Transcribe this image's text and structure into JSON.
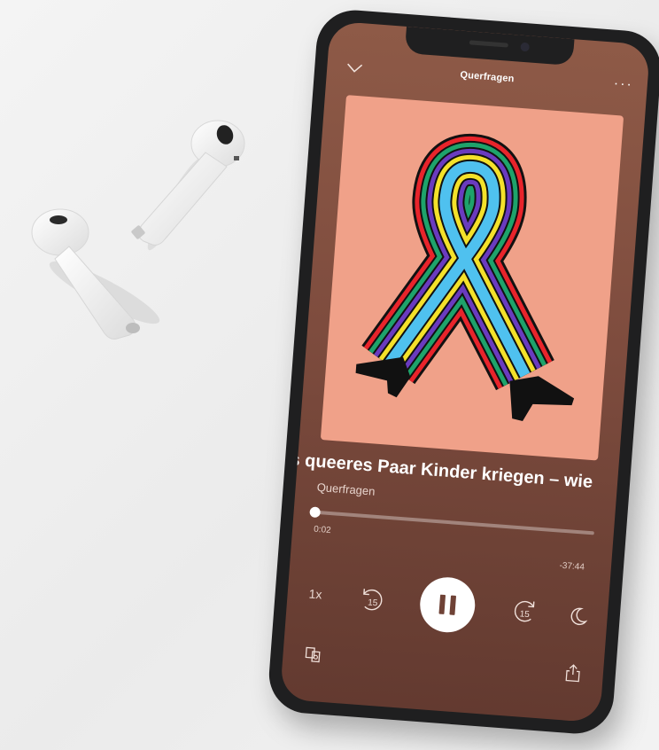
{
  "app": {
    "header_title": "Querfragen",
    "more_icon": "more-options-icon",
    "collapse_icon": "chevron-down-icon"
  },
  "episode": {
    "title": "Als queeres Paar Kinder kriegen – wie",
    "title_visible": "ls queeres Paar Kinder kriegen – wie",
    "show": "Querfragen"
  },
  "playback": {
    "elapsed": "0:02",
    "remaining": "-37:44",
    "progress_fraction": 0.0,
    "speed_label": "1x",
    "skip_back_seconds": "15",
    "skip_forward_seconds": "15",
    "state": "playing"
  },
  "icons": {
    "skip_back": "skip-back-15-icon",
    "play_pause": "pause-icon",
    "skip_forward": "skip-forward-15-icon",
    "sleep_timer": "moon-icon",
    "devices": "connect-device-icon",
    "share": "share-icon"
  },
  "colors": {
    "player_background_top": "#8e5a47",
    "player_background_bottom": "#633a30",
    "cover_background": "#f0a189"
  }
}
